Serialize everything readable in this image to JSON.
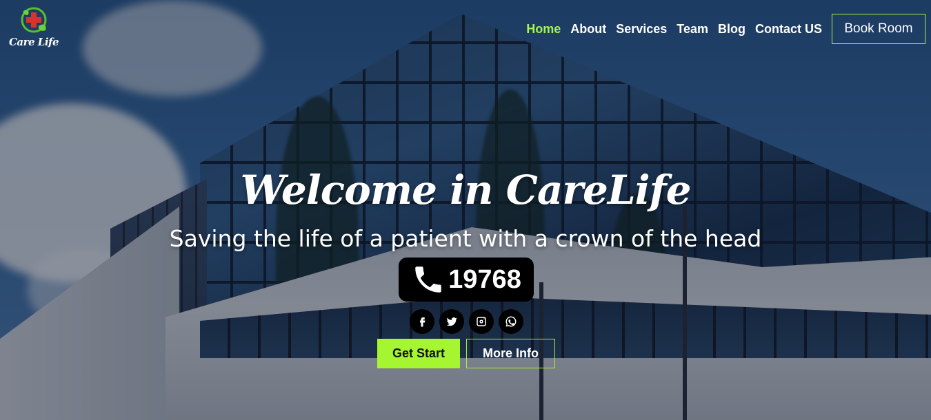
{
  "brand": {
    "logo_text": "Care Life",
    "accent_color": "#a6f54a"
  },
  "nav": {
    "items": [
      {
        "label": "Home",
        "active": true
      },
      {
        "label": "About",
        "active": false
      },
      {
        "label": "Services",
        "active": false
      },
      {
        "label": "Team",
        "active": false
      },
      {
        "label": "Blog",
        "active": false
      },
      {
        "label": "Contact US",
        "active": false
      }
    ],
    "book_label": "Book Room"
  },
  "hero": {
    "title": "Welcome in CareLife",
    "subtitle": "Saving the life of a patient with a crown of the head",
    "phone_number": "19768",
    "phone_icon": "phone-icon",
    "socials": [
      {
        "icon": "facebook-icon"
      },
      {
        "icon": "twitter-icon"
      },
      {
        "icon": "instagram-icon"
      },
      {
        "icon": "whatsapp-icon"
      }
    ],
    "primary_cta": "Get Start",
    "secondary_cta": "More Info"
  }
}
